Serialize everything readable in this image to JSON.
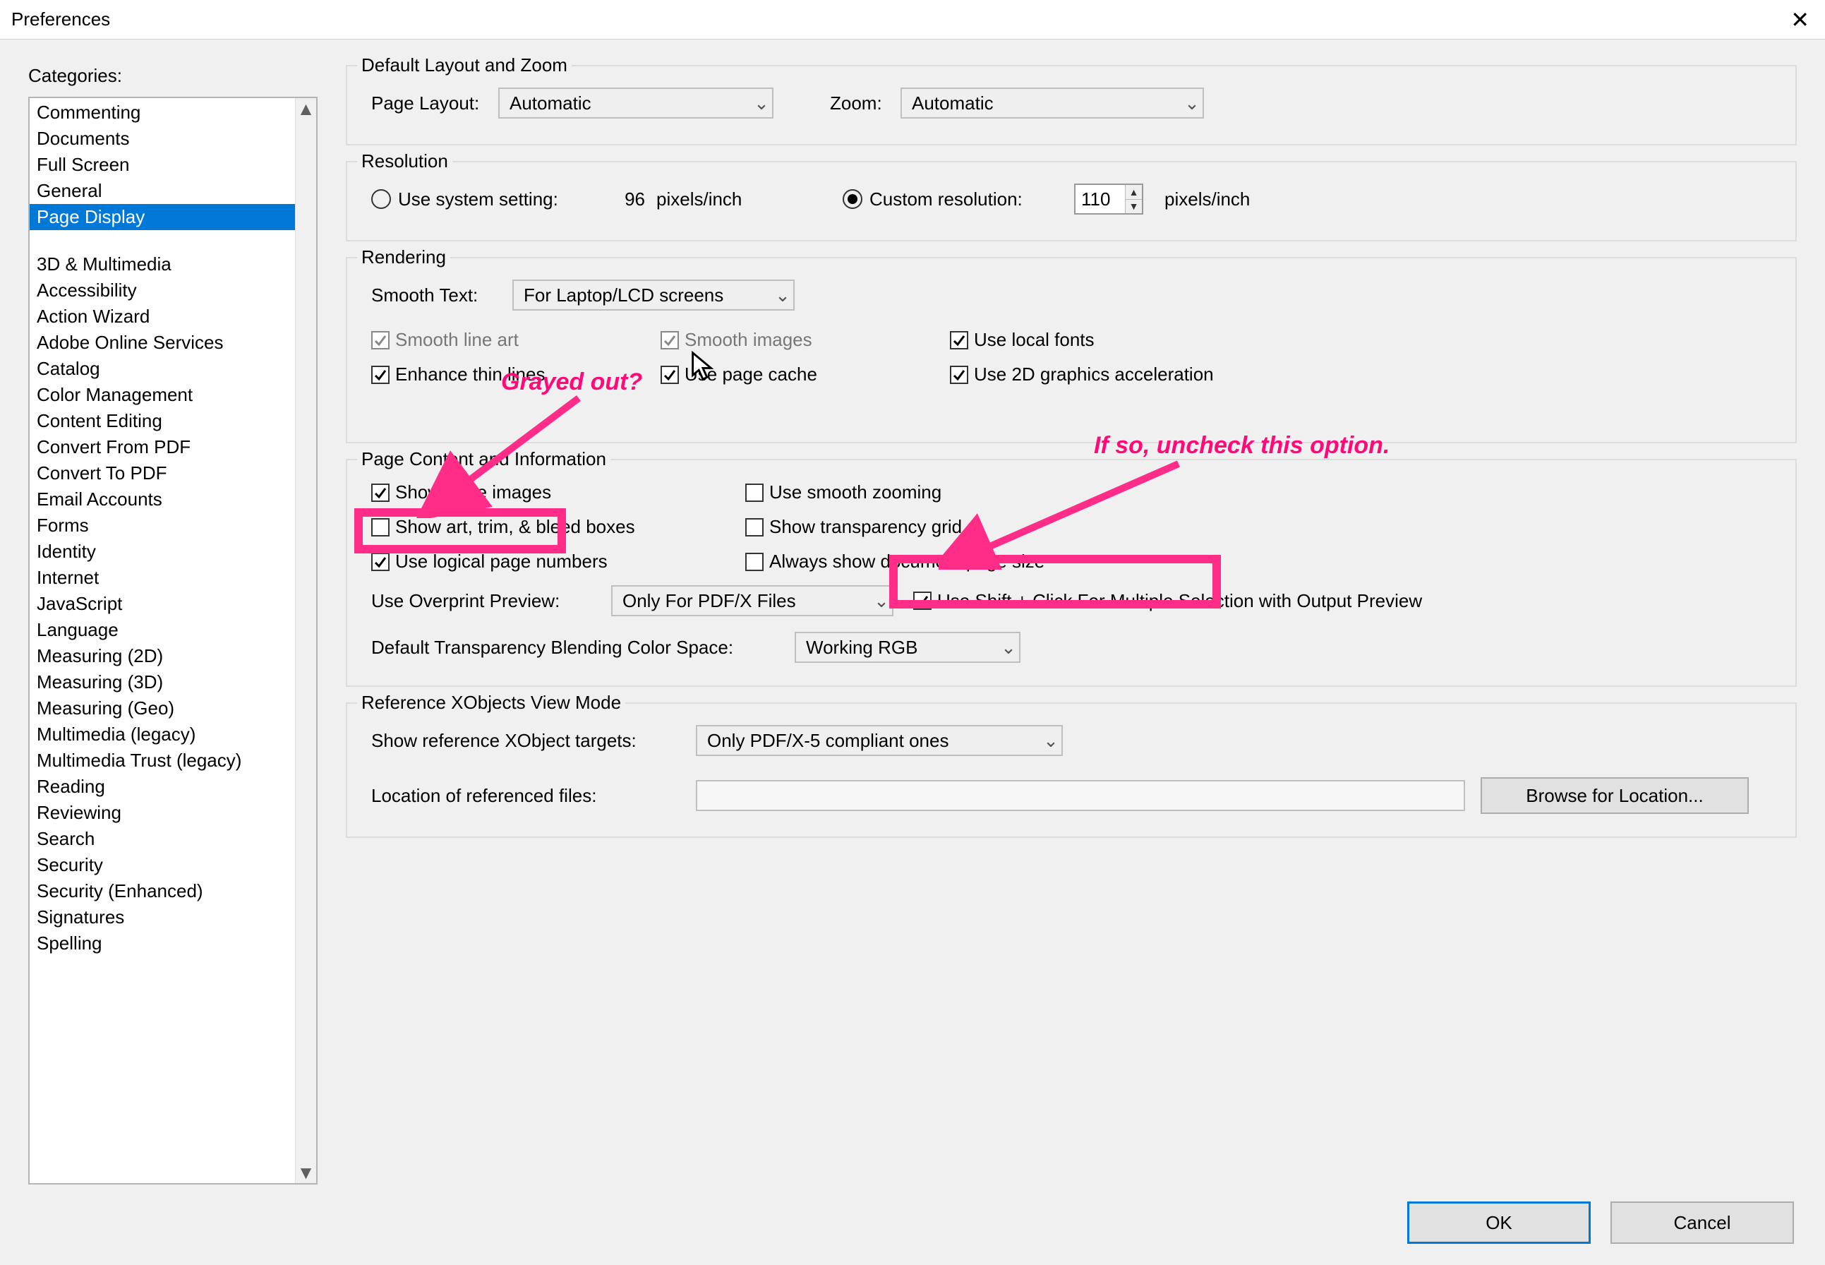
{
  "window": {
    "title": "Preferences"
  },
  "left": {
    "label": "Categories:",
    "items": [
      "Commenting",
      "Documents",
      "Full Screen",
      "General",
      "Page Display",
      "3D & Multimedia",
      "Accessibility",
      "Action Wizard",
      "Adobe Online Services",
      "Catalog",
      "Color Management",
      "Content Editing",
      "Convert From PDF",
      "Convert To PDF",
      "Email Accounts",
      "Forms",
      "Identity",
      "Internet",
      "JavaScript",
      "Language",
      "Measuring (2D)",
      "Measuring (3D)",
      "Measuring (Geo)",
      "Multimedia (legacy)",
      "Multimedia Trust (legacy)",
      "Reading",
      "Reviewing",
      "Search",
      "Security",
      "Security (Enhanced)",
      "Signatures",
      "Spelling"
    ],
    "selected": "Page Display"
  },
  "layoutZoom": {
    "legend": "Default Layout and Zoom",
    "pageLayoutLabel": "Page Layout:",
    "pageLayoutValue": "Automatic",
    "zoomLabel": "Zoom:",
    "zoomValue": "Automatic"
  },
  "resolution": {
    "legend": "Resolution",
    "useSystemLabel": "Use system setting:",
    "systemValue": "96",
    "unit": "pixels/inch",
    "customLabel": "Custom resolution:",
    "customValue": "110",
    "selected": "custom"
  },
  "rendering": {
    "legend": "Rendering",
    "smoothTextLabel": "Smooth Text:",
    "smoothTextValue": "For Laptop/LCD screens",
    "smoothLineArt": "Smooth line art",
    "smoothImages": "Smooth images",
    "useLocalFonts": "Use local fonts",
    "enhanceThinLines": "Enhance thin lines",
    "usePageCache": "Use page cache",
    "use2DAccel": "Use 2D graphics acceleration"
  },
  "pageContent": {
    "legend": "Page Content and Information",
    "showLargeImages": "Show large images",
    "useSmoothZooming": "Use smooth zooming",
    "showArtTrimBleed": "Show art, trim, & bleed boxes",
    "showTransparencyGrid": "Show transparency grid",
    "useLogicalPageNumbers": "Use logical page numbers",
    "alwaysShowPageSize": "Always show document page size",
    "overprintLabel": "Use Overprint Preview:",
    "overprintValue": "Only For PDF/X Files",
    "shiftClickLabel": "Use Shift + Click For Multiple Selection with Output Preview",
    "blendingLabel": "Default Transparency Blending Color Space:",
    "blendingValue": "Working RGB"
  },
  "refXObjects": {
    "legend": "Reference XObjects View Mode",
    "showTargetsLabel": "Show reference XObject targets:",
    "showTargetsValue": "Only PDF/X-5 compliant ones",
    "locationLabel": "Location of referenced files:",
    "browseBtn": "Browse for Location..."
  },
  "footer": {
    "ok": "OK",
    "cancel": "Cancel"
  },
  "annotations": {
    "grayedOut": "Grayed out?",
    "ifSo": "If so, uncheck this option."
  }
}
